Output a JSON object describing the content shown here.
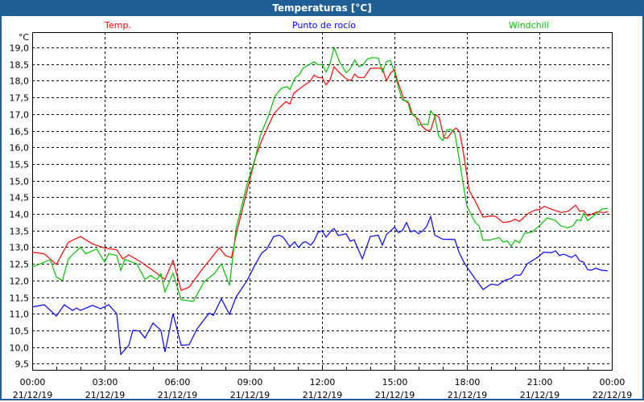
{
  "chart_data": {
    "type": "line",
    "title": "Temperaturas [°C]",
    "ylabel": "°C",
    "xlabel": "",
    "ylim": [
      9.5,
      19.0
    ],
    "xlim_hours": [
      0,
      24
    ],
    "grid": true,
    "yticks": [
      "9,5",
      "10,0",
      "10,5",
      "11,0",
      "11,5",
      "12,0",
      "12,5",
      "13,0",
      "13,5",
      "14,0",
      "14,5",
      "15,0",
      "15,5",
      "16,0",
      "16,5",
      "17,0",
      "17,5",
      "18,0",
      "18,5",
      "19,0"
    ],
    "yticks_values": [
      9.5,
      10,
      10.5,
      11,
      11.5,
      12,
      12.5,
      13,
      13.5,
      14,
      14.5,
      15,
      15.5,
      16,
      16.5,
      17,
      17.5,
      18,
      18.5,
      19
    ],
    "xticks": [
      {
        "time": "00:00",
        "date": "21/12/19"
      },
      {
        "time": "03:00",
        "date": "21/12/19"
      },
      {
        "time": "06:00",
        "date": "21/12/19"
      },
      {
        "time": "09:00",
        "date": "21/12/19"
      },
      {
        "time": "12:00",
        "date": "21/12/19"
      },
      {
        "time": "15:00",
        "date": "21/12/19"
      },
      {
        "time": "18:00",
        "date": "21/12/19"
      },
      {
        "time": "21:00",
        "date": "21/12/19"
      },
      {
        "time": "00:00",
        "date": "22/12/19"
      }
    ],
    "series": [
      {
        "name": "Temp.",
        "color": "#ff0000",
        "points": [
          [
            0,
            12.85
          ],
          [
            0.5,
            12.8
          ],
          [
            1,
            12.48
          ],
          [
            1.5,
            13.15
          ],
          [
            2,
            13.32
          ],
          [
            2.5,
            13.1
          ],
          [
            3,
            12.97
          ],
          [
            3.5,
            12.92
          ],
          [
            3.75,
            12.65
          ],
          [
            4,
            12.77
          ],
          [
            4.5,
            12.55
          ],
          [
            5,
            12.3
          ],
          [
            5.5,
            12.03
          ],
          [
            5.83,
            12.6
          ],
          [
            6.17,
            11.7
          ],
          [
            6.5,
            11.8
          ],
          [
            7,
            12.3
          ],
          [
            7.5,
            12.75
          ],
          [
            7.75,
            12.98
          ],
          [
            8,
            12.75
          ],
          [
            8.25,
            12.68
          ],
          [
            8.5,
            13.55
          ],
          [
            9,
            15.0
          ],
          [
            9.25,
            15.7
          ],
          [
            9.5,
            16.2
          ],
          [
            9.75,
            16.6
          ],
          [
            10,
            17.0
          ],
          [
            10.25,
            17.2
          ],
          [
            10.5,
            17.37
          ],
          [
            10.67,
            17.3
          ],
          [
            10.83,
            17.62
          ],
          [
            11,
            17.72
          ],
          [
            11.25,
            17.86
          ],
          [
            11.5,
            17.97
          ],
          [
            11.67,
            18.17
          ],
          [
            11.83,
            18.1
          ],
          [
            12,
            18.1
          ],
          [
            12.17,
            17.88
          ],
          [
            12.33,
            18.02
          ],
          [
            12.5,
            18.42
          ],
          [
            12.75,
            18.22
          ],
          [
            13,
            18.06
          ],
          [
            13.2,
            18.0
          ],
          [
            13.35,
            18.2
          ],
          [
            13.5,
            18.1
          ],
          [
            13.75,
            18.1
          ],
          [
            14,
            18.37
          ],
          [
            14.25,
            18.38
          ],
          [
            14.5,
            18.37
          ],
          [
            14.67,
            18.0
          ],
          [
            14.83,
            18.22
          ],
          [
            15,
            18.34
          ],
          [
            15.1,
            18.06
          ],
          [
            15.25,
            17.74
          ],
          [
            15.4,
            17.42
          ],
          [
            15.6,
            17.32
          ],
          [
            15.75,
            16.98
          ],
          [
            16,
            16.84
          ],
          [
            16.15,
            16.62
          ],
          [
            16.35,
            16.5
          ],
          [
            16.5,
            16.52
          ],
          [
            16.7,
            16.98
          ],
          [
            16.85,
            16.9
          ],
          [
            17.05,
            16.28
          ],
          [
            17.2,
            16.28
          ],
          [
            17.4,
            16.49
          ],
          [
            17.55,
            16.58
          ],
          [
            17.7,
            16.46
          ],
          [
            17.85,
            15.86
          ],
          [
            18.1,
            14.69
          ],
          [
            18.33,
            14.4
          ],
          [
            18.67,
            13.9
          ],
          [
            19,
            13.94
          ],
          [
            19.2,
            13.92
          ],
          [
            19.5,
            13.74
          ],
          [
            19.8,
            13.77
          ],
          [
            20,
            13.84
          ],
          [
            20.17,
            13.77
          ],
          [
            20.55,
            14.02
          ],
          [
            20.85,
            14.12
          ],
          [
            21,
            14.12
          ],
          [
            21.2,
            14.23
          ],
          [
            21.5,
            14.14
          ],
          [
            21.9,
            14.04
          ],
          [
            22.2,
            14.08
          ],
          [
            22.5,
            14.26
          ],
          [
            22.67,
            14.08
          ],
          [
            22.83,
            14.1
          ],
          [
            23,
            13.94
          ],
          [
            23.4,
            14.06
          ],
          [
            23.67,
            14.04
          ],
          [
            23.85,
            14.06
          ]
        ]
      },
      {
        "name": "Punto de rocío",
        "color": "#0000ff",
        "points": [
          [
            0,
            11.2
          ],
          [
            0.5,
            11.27
          ],
          [
            1,
            10.93
          ],
          [
            1.33,
            11.27
          ],
          [
            1.67,
            11.1
          ],
          [
            1.83,
            11.17
          ],
          [
            2,
            11.1
          ],
          [
            2.5,
            11.25
          ],
          [
            2.83,
            11.15
          ],
          [
            3.17,
            11.27
          ],
          [
            3.5,
            11.0
          ],
          [
            3.67,
            9.78
          ],
          [
            4,
            10.05
          ],
          [
            4.17,
            10.5
          ],
          [
            4.44,
            10.48
          ],
          [
            4.67,
            10.27
          ],
          [
            5,
            10.72
          ],
          [
            5.33,
            10.5
          ],
          [
            5.5,
            9.85
          ],
          [
            5.83,
            11.0
          ],
          [
            6.17,
            10.05
          ],
          [
            6.5,
            10.07
          ],
          [
            6.83,
            10.55
          ],
          [
            7.33,
            11.02
          ],
          [
            7.5,
            10.95
          ],
          [
            7.83,
            11.45
          ],
          [
            8.17,
            10.98
          ],
          [
            8.44,
            11.5
          ],
          [
            8.9,
            12.0
          ],
          [
            9.25,
            12.5
          ],
          [
            9.5,
            12.82
          ],
          [
            9.72,
            12.95
          ],
          [
            10,
            13.32
          ],
          [
            10.22,
            13.36
          ],
          [
            10.39,
            13.3
          ],
          [
            10.67,
            13.02
          ],
          [
            10.87,
            13.16
          ],
          [
            11.02,
            12.99
          ],
          [
            11.22,
            13.14
          ],
          [
            11.33,
            13.16
          ],
          [
            11.53,
            13.06
          ],
          [
            11.67,
            13.18
          ],
          [
            11.83,
            13.44
          ],
          [
            12,
            13.49
          ],
          [
            12.17,
            13.3
          ],
          [
            12.39,
            13.5
          ],
          [
            12.5,
            13.56
          ],
          [
            12.67,
            13.35
          ],
          [
            13,
            13.4
          ],
          [
            13.17,
            13.18
          ],
          [
            13.33,
            13.22
          ],
          [
            13.67,
            12.65
          ],
          [
            14,
            13.32
          ],
          [
            14.33,
            13.36
          ],
          [
            14.5,
            13.06
          ],
          [
            14.67,
            13.38
          ],
          [
            15,
            13.6
          ],
          [
            15.17,
            13.44
          ],
          [
            15.33,
            13.5
          ],
          [
            15.5,
            13.74
          ],
          [
            15.67,
            13.46
          ],
          [
            15.83,
            13.5
          ],
          [
            16,
            13.4
          ],
          [
            16.17,
            13.49
          ],
          [
            16.33,
            13.62
          ],
          [
            16.5,
            13.92
          ],
          [
            16.67,
            13.36
          ],
          [
            17,
            13.24
          ],
          [
            17.5,
            13.23
          ],
          [
            17.67,
            12.85
          ],
          [
            17.89,
            12.53
          ],
          [
            18.1,
            12.3
          ],
          [
            18.33,
            12.06
          ],
          [
            18.67,
            11.73
          ],
          [
            19,
            11.89
          ],
          [
            19.28,
            11.86
          ],
          [
            19.61,
            12.02
          ],
          [
            19.83,
            12.06
          ],
          [
            20,
            12.16
          ],
          [
            20.22,
            12.16
          ],
          [
            20.5,
            12.5
          ],
          [
            20.78,
            12.63
          ],
          [
            21,
            12.73
          ],
          [
            21.17,
            12.85
          ],
          [
            21.5,
            12.83
          ],
          [
            21.67,
            12.89
          ],
          [
            21.83,
            12.75
          ],
          [
            22,
            12.79
          ],
          [
            22.33,
            12.69
          ],
          [
            22.5,
            12.77
          ],
          [
            22.67,
            12.59
          ],
          [
            22.83,
            12.55
          ],
          [
            23,
            12.32
          ],
          [
            23.17,
            12.31
          ],
          [
            23.33,
            12.37
          ],
          [
            23.56,
            12.31
          ],
          [
            23.83,
            12.29
          ]
        ]
      },
      {
        "name": "Windchill",
        "color": "#00c000",
        "points": [
          [
            0,
            12.4
          ],
          [
            0.5,
            12.55
          ],
          [
            0.75,
            12.62
          ],
          [
            1,
            12.1
          ],
          [
            1.25,
            12.0
          ],
          [
            1.5,
            12.65
          ],
          [
            2,
            13.0
          ],
          [
            2.22,
            12.8
          ],
          [
            2.67,
            12.95
          ],
          [
            3,
            12.55
          ],
          [
            3.17,
            12.8
          ],
          [
            3.5,
            12.75
          ],
          [
            3.67,
            12.3
          ],
          [
            3.83,
            12.63
          ],
          [
            4.33,
            12.5
          ],
          [
            4.67,
            12.03
          ],
          [
            4.9,
            12.15
          ],
          [
            5.17,
            12.03
          ],
          [
            5.33,
            12.2
          ],
          [
            5.5,
            11.65
          ],
          [
            5.83,
            12.22
          ],
          [
            6.17,
            11.42
          ],
          [
            6.67,
            11.37
          ],
          [
            7.11,
            11.95
          ],
          [
            7.56,
            12.22
          ],
          [
            7.83,
            12.5
          ],
          [
            8.17,
            11.85
          ],
          [
            8.44,
            13.55
          ],
          [
            8.9,
            14.9
          ],
          [
            9.25,
            15.7
          ],
          [
            9.44,
            16.34
          ],
          [
            9.78,
            16.94
          ],
          [
            10.06,
            17.54
          ],
          [
            10.33,
            17.78
          ],
          [
            10.56,
            17.82
          ],
          [
            10.67,
            17.74
          ],
          [
            10.89,
            18.09
          ],
          [
            11.06,
            18.18
          ],
          [
            11.22,
            18.38
          ],
          [
            11.67,
            18.57
          ],
          [
            11.83,
            18.48
          ],
          [
            12,
            18.49
          ],
          [
            12.17,
            18.26
          ],
          [
            12.33,
            18.5
          ],
          [
            12.5,
            19.0
          ],
          [
            12.72,
            18.58
          ],
          [
            13,
            18.24
          ],
          [
            13.17,
            18.36
          ],
          [
            13.35,
            18.62
          ],
          [
            13.53,
            18.42
          ],
          [
            13.67,
            18.46
          ],
          [
            13.89,
            18.66
          ],
          [
            14.06,
            18.69
          ],
          [
            14.33,
            18.68
          ],
          [
            14.5,
            18.26
          ],
          [
            14.67,
            18.57
          ],
          [
            14.83,
            18.61
          ],
          [
            15,
            18.26
          ],
          [
            15.17,
            17.78
          ],
          [
            15.33,
            17.42
          ],
          [
            15.56,
            17.38
          ],
          [
            15.67,
            17.02
          ],
          [
            15.89,
            16.92
          ],
          [
            16,
            16.66
          ],
          [
            16.22,
            16.7
          ],
          [
            16.39,
            16.68
          ],
          [
            16.5,
            17.1
          ],
          [
            16.67,
            16.94
          ],
          [
            16.83,
            16.34
          ],
          [
            17,
            16.2
          ],
          [
            17.17,
            16.52
          ],
          [
            17.33,
            16.54
          ],
          [
            17.5,
            16.42
          ],
          [
            17.67,
            15.7
          ],
          [
            17.9,
            14.66
          ],
          [
            18.0,
            14.24
          ],
          [
            18.33,
            13.76
          ],
          [
            18.5,
            13.64
          ],
          [
            18.67,
            13.21
          ],
          [
            19,
            13.22
          ],
          [
            19.33,
            13.29
          ],
          [
            19.5,
            13.15
          ],
          [
            19.67,
            13.19
          ],
          [
            19.83,
            13.03
          ],
          [
            20,
            13.21
          ],
          [
            20.17,
            13.13
          ],
          [
            20.39,
            13.42
          ],
          [
            20.67,
            13.44
          ],
          [
            21,
            13.64
          ],
          [
            21.33,
            13.88
          ],
          [
            21.67,
            13.8
          ],
          [
            21.89,
            13.64
          ],
          [
            22.17,
            13.58
          ],
          [
            22.39,
            13.64
          ],
          [
            22.56,
            13.82
          ],
          [
            22.72,
            13.8
          ],
          [
            22.83,
            14.02
          ],
          [
            23,
            13.8
          ],
          [
            23.33,
            13.99
          ],
          [
            23.61,
            14.15
          ],
          [
            23.83,
            14.16
          ]
        ]
      }
    ]
  }
}
